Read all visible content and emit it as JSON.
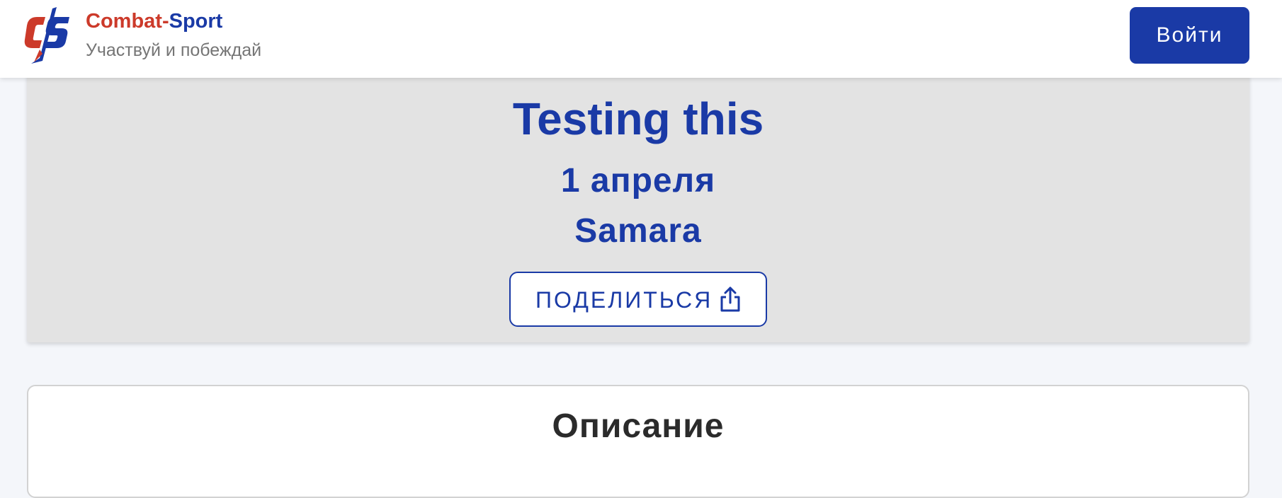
{
  "header": {
    "brand_part_1": "Combat-",
    "brand_part_2": "Sport",
    "tagline": "Участвуй и побеждай",
    "login_label": "Войти",
    "logo_icon": "combat-sport-cs-logo-icon"
  },
  "event": {
    "title": "Testing this",
    "date": "1 апреля",
    "city": "Samara",
    "share_label": "ПОДЕЛИТЬСЯ",
    "share_icon": "share-icon"
  },
  "description": {
    "title": "Описание"
  },
  "colors": {
    "primary": "#1a3aa6",
    "brand_red": "#cc3a2a",
    "page_background": "#f4f6fa",
    "hero_background": "#e3e3e3",
    "tagline_gray": "#757575",
    "heading_dark": "#2b2b2b"
  }
}
